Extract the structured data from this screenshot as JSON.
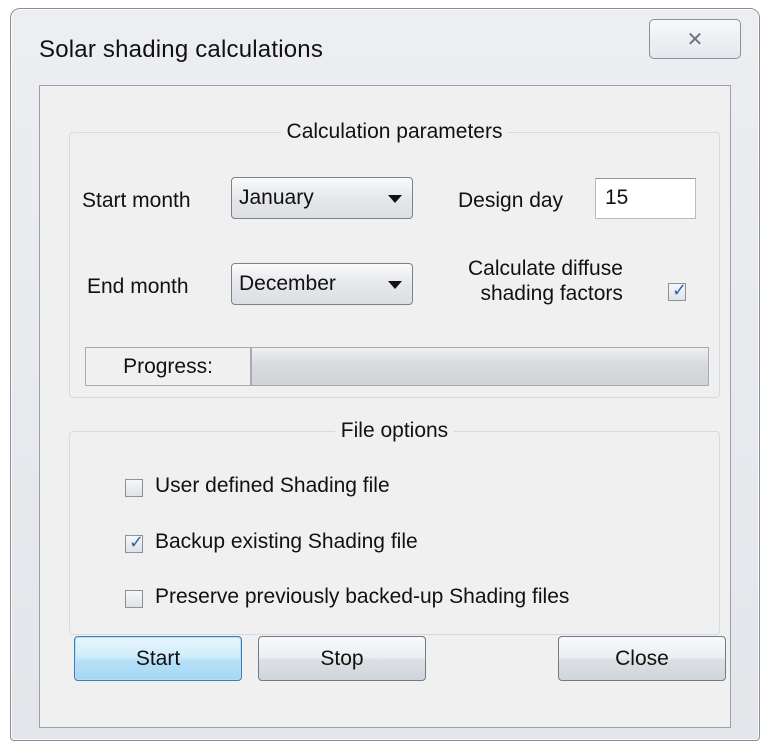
{
  "window": {
    "title": "Solar shading calculations",
    "close_icon": "close-icon",
    "close_glyph": "✕"
  },
  "calculation_parameters": {
    "legend": "Calculation parameters",
    "start_month_label": "Start month",
    "start_month_value": "January",
    "design_day_label": "Design day",
    "design_day_value": "15",
    "end_month_label": "End month",
    "end_month_value": "December",
    "diffuse_label_line1": "Calculate diffuse",
    "diffuse_label_line2": "shading factors",
    "diffuse_checked": true,
    "progress_label": "Progress:",
    "progress_value": 0
  },
  "file_options": {
    "legend": "File options",
    "items": [
      {
        "label": "User defined Shading file",
        "checked": false
      },
      {
        "label": "Backup existing Shading file",
        "checked": true
      },
      {
        "label": "Preserve previously backed-up Shading files",
        "checked": false
      }
    ]
  },
  "buttons": {
    "start": "Start",
    "stop": "Stop",
    "close": "Close"
  },
  "colors": {
    "accent": "#2f63b8",
    "primary_button": "#b8e0f7"
  },
  "checkmark_glyph": "✓",
  "dropdown_icon": "chevron-down-icon"
}
